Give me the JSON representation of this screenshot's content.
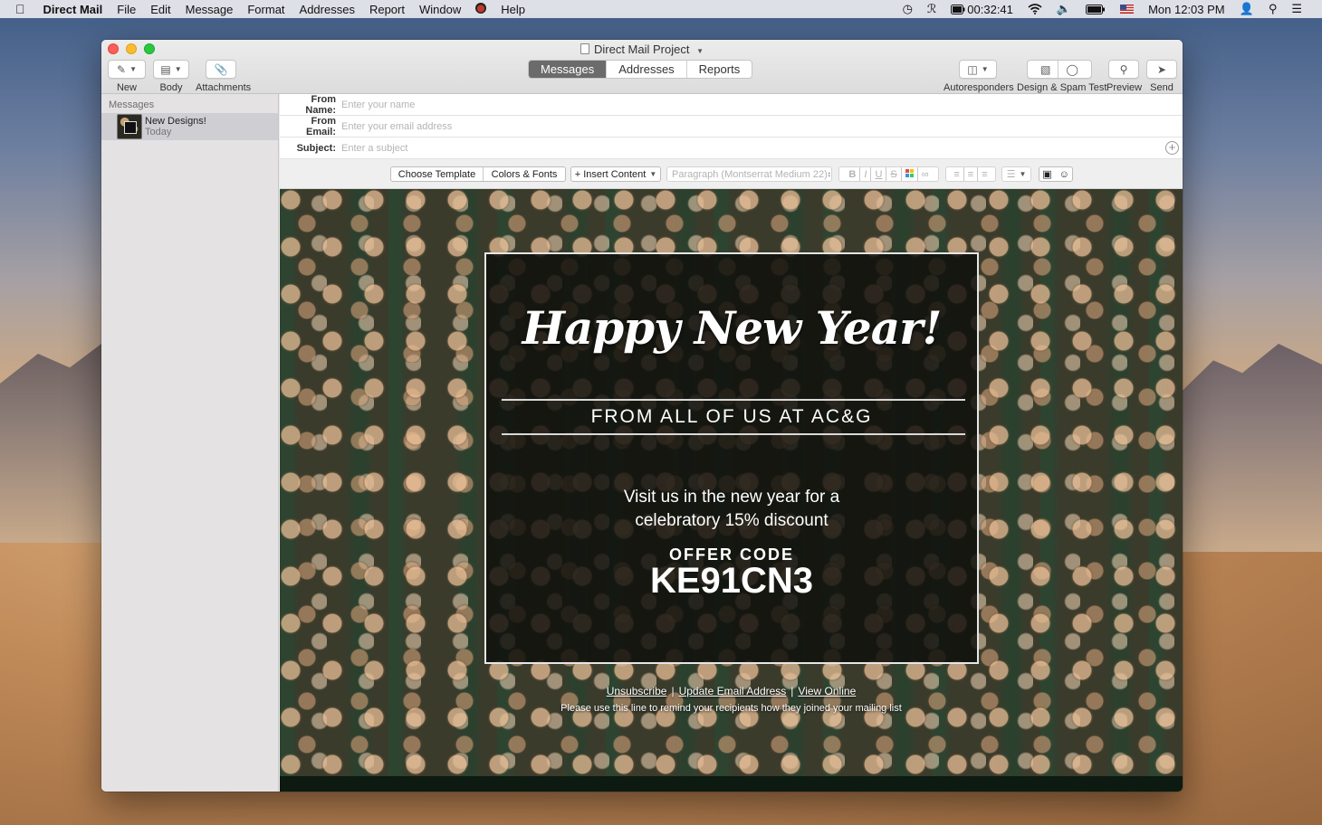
{
  "menubar": {
    "apple": "",
    "app": "Direct Mail",
    "items": [
      "File",
      "Edit",
      "Message",
      "Format",
      "Addresses",
      "Report",
      "Window",
      "Help"
    ],
    "status": {
      "battery_time": "00:32:41",
      "clock": "Mon 12:03 PM"
    }
  },
  "window": {
    "title": "Direct Mail Project",
    "toolbar": {
      "new": "New",
      "body": "Body",
      "attachments": "Attachments",
      "autoresponders": "Autoresponders",
      "design_spam": "Design & Spam Test",
      "preview": "Preview",
      "send": "Send"
    },
    "tabs": [
      "Messages",
      "Addresses",
      "Reports"
    ],
    "active_tab": "Messages"
  },
  "sidebar": {
    "header": "Messages",
    "items": [
      {
        "title": "New Designs!",
        "date": "Today"
      }
    ]
  },
  "form": {
    "from_name_label": "From Name:",
    "from_name_placeholder": "Enter your name",
    "from_email_label": "From Email:",
    "from_email_placeholder": "Enter your email address",
    "subject_label": "Subject:",
    "subject_placeholder": "Enter a subject"
  },
  "format_bar": {
    "choose_template": "Choose Template",
    "colors_fonts": "Colors & Fonts",
    "insert_content": "+ Insert Content",
    "paragraph_style": "Paragraph (Montserrat Medium 22)",
    "bold": "B",
    "italic": "I",
    "underline": "U",
    "strike": "S"
  },
  "email": {
    "headline": "Happy New Year!",
    "subtitle": "FROM ALL OF US AT AC&G",
    "visit_line1": "Visit us in the new year for a",
    "visit_line2": "celebratory 15% discount",
    "offer_label": "OFFER CODE",
    "offer_code": "KE91CN3",
    "link_unsubscribe": "Unsubscribe",
    "link_update": "Update Email Address",
    "link_view": "View Online",
    "separator": "|",
    "reminder": "Please use this line to remind your recipients how they joined your mailing list"
  },
  "colors": {
    "active_tab_bg": "#6b6b6b",
    "card_bg": "#0f0f0c",
    "light_red": "#fc5f57",
    "light_yellow": "#fdbc2e",
    "light_green": "#28c840"
  }
}
